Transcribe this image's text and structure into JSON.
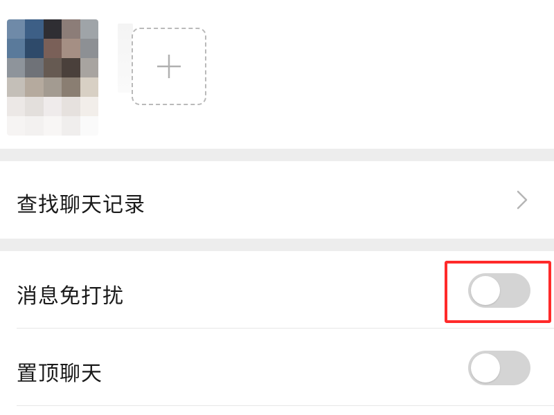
{
  "members": {
    "avatar_colors": [
      "#6f8aa8",
      "#3d5f86",
      "#2f2e33",
      "#8c7d78",
      "#9fa4a8",
      "#5a7a9b",
      "#2e4a6a",
      "#7a6058",
      "#a58f84",
      "#8d9094",
      "#8e949b",
      "#6f7278",
      "#665a52",
      "#4a403b",
      "#a8a4a0",
      "#c4bfb8",
      "#b5aa9e",
      "#a39b91",
      "#8a7e72",
      "#d8d0c4",
      "#ece8e6",
      "#e3dfdc",
      "#efebeb",
      "#e6e1de",
      "#f2eeea",
      "#f6f4f3",
      "#f3f1f0",
      "#f8f6f5",
      "#f0eeed",
      "#fafafa"
    ],
    "add_icon": "plus-icon"
  },
  "search_history": {
    "label": "查找聊天记录",
    "icon": "chevron-right-icon"
  },
  "mute_notifications": {
    "label": "消息免打扰",
    "enabled": false
  },
  "pin_chat": {
    "label": "置顶聊天",
    "enabled": false
  },
  "highlight_color": "#ff2a2a",
  "toggle_off_color": "#d4d4d4"
}
